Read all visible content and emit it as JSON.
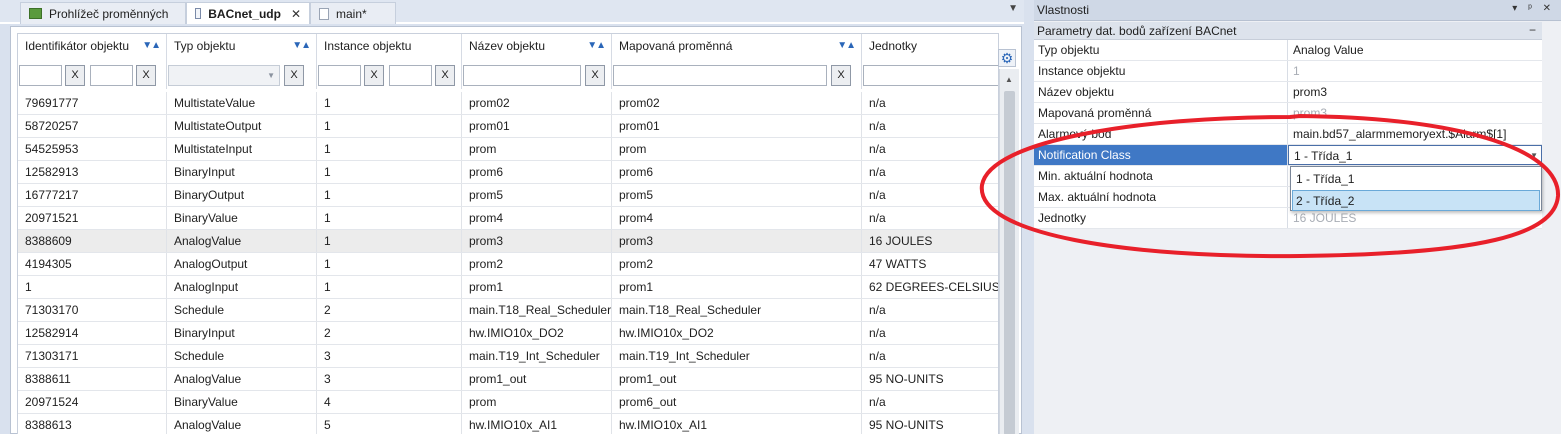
{
  "tabs": [
    {
      "label": "Prohlížeč proměnných",
      "icon": "variable-browser-icon",
      "active": false
    },
    {
      "label": "BACnet_udp",
      "icon": "bacnet-icon",
      "active": true,
      "close": "✕"
    },
    {
      "label": "main*",
      "icon": "file-icon",
      "active": false
    }
  ],
  "tab_menu_glyph": "▼",
  "grid": {
    "columns": [
      {
        "label": "Identifikátor objektu",
        "sort": "▼▲"
      },
      {
        "label": "Typ objektu",
        "sort": "▼▲"
      },
      {
        "label": "Instance objektu",
        "sort": "▼▲"
      },
      {
        "label": "Název objektu",
        "sort": "▼▲"
      },
      {
        "label": "Mapovaná proměnná",
        "sort": "▼▲"
      },
      {
        "label": "Jednotky",
        "sort": ""
      }
    ],
    "filter_clear_label": "X",
    "rows": [
      [
        "79691777",
        "MultistateValue",
        "1",
        "prom02",
        "prom02",
        "n/a"
      ],
      [
        "58720257",
        "MultistateOutput",
        "1",
        "prom01",
        "prom01",
        "n/a"
      ],
      [
        "54525953",
        "MultistateInput",
        "1",
        "prom",
        "prom",
        "n/a"
      ],
      [
        "12582913",
        "BinaryInput",
        "1",
        "prom6",
        "prom6",
        "n/a"
      ],
      [
        "16777217",
        "BinaryOutput",
        "1",
        "prom5",
        "prom5",
        "n/a"
      ],
      [
        "20971521",
        "BinaryValue",
        "1",
        "prom4",
        "prom4",
        "n/a"
      ],
      [
        "8388609",
        "AnalogValue",
        "1",
        "prom3",
        "prom3",
        "16 JOULES"
      ],
      [
        "4194305",
        "AnalogOutput",
        "1",
        "prom2",
        "prom2",
        "47 WATTS"
      ],
      [
        "1",
        "AnalogInput",
        "1",
        "prom1",
        "prom1",
        "62 DEGREES-CELSIUS"
      ],
      [
        "71303170",
        "Schedule",
        "2",
        "main.T18_Real_Scheduler",
        "main.T18_Real_Scheduler",
        "n/a"
      ],
      [
        "12582914",
        "BinaryInput",
        "2",
        "hw.IMIO10x_DO2",
        "hw.IMIO10x_DO2",
        "n/a"
      ],
      [
        "71303171",
        "Schedule",
        "3",
        "main.T19_Int_Scheduler",
        "main.T19_Int_Scheduler",
        "n/a"
      ],
      [
        "8388611",
        "AnalogValue",
        "3",
        "prom1_out",
        "prom1_out",
        "95 NO-UNITS"
      ],
      [
        "20971524",
        "BinaryValue",
        "4",
        "prom",
        "prom6_out",
        "n/a"
      ],
      [
        "8388613",
        "AnalogValue",
        "5",
        "hw.IMIO10x_AI1",
        "hw.IMIO10x_AI1",
        "95 NO-UNITS"
      ]
    ],
    "selected_row": 6
  },
  "properties": {
    "title": "Vlastnosti",
    "title_controls": "▾ ᵖ ✕",
    "category": "Parametry dat. bodů zařízení BACnet",
    "category_collapse": "−",
    "rows": [
      {
        "name": "Typ objektu",
        "value": "Analog Value",
        "grey": false
      },
      {
        "name": "Instance objektu",
        "value": "1",
        "grey": true
      },
      {
        "name": "Název objektu",
        "value": "prom3",
        "grey": false
      },
      {
        "name": "Mapovaná proměnná",
        "value": "prom3",
        "grey": true
      },
      {
        "name": "Alarmový bod",
        "value": "main.bd57_alarmmemoryext.$Alarm$[1]",
        "grey": false
      },
      {
        "name": "Notification Class",
        "value": "1 - Třída_1",
        "grey": false,
        "highlighted": true
      },
      {
        "name": "Min. aktuální hodnota",
        "value": "",
        "grey": false
      },
      {
        "name": "Max. aktuální hodnota",
        "value": "",
        "grey": false
      },
      {
        "name": "Jednotky",
        "value": "16 JOULES",
        "grey": true
      }
    ],
    "dropdown_options": [
      "1 - Třída_1",
      "2 - Třída_2"
    ],
    "dropdown_hover_index": 1
  },
  "colors": {
    "accent": "#3f78c5",
    "annotation": "#e8202a"
  }
}
